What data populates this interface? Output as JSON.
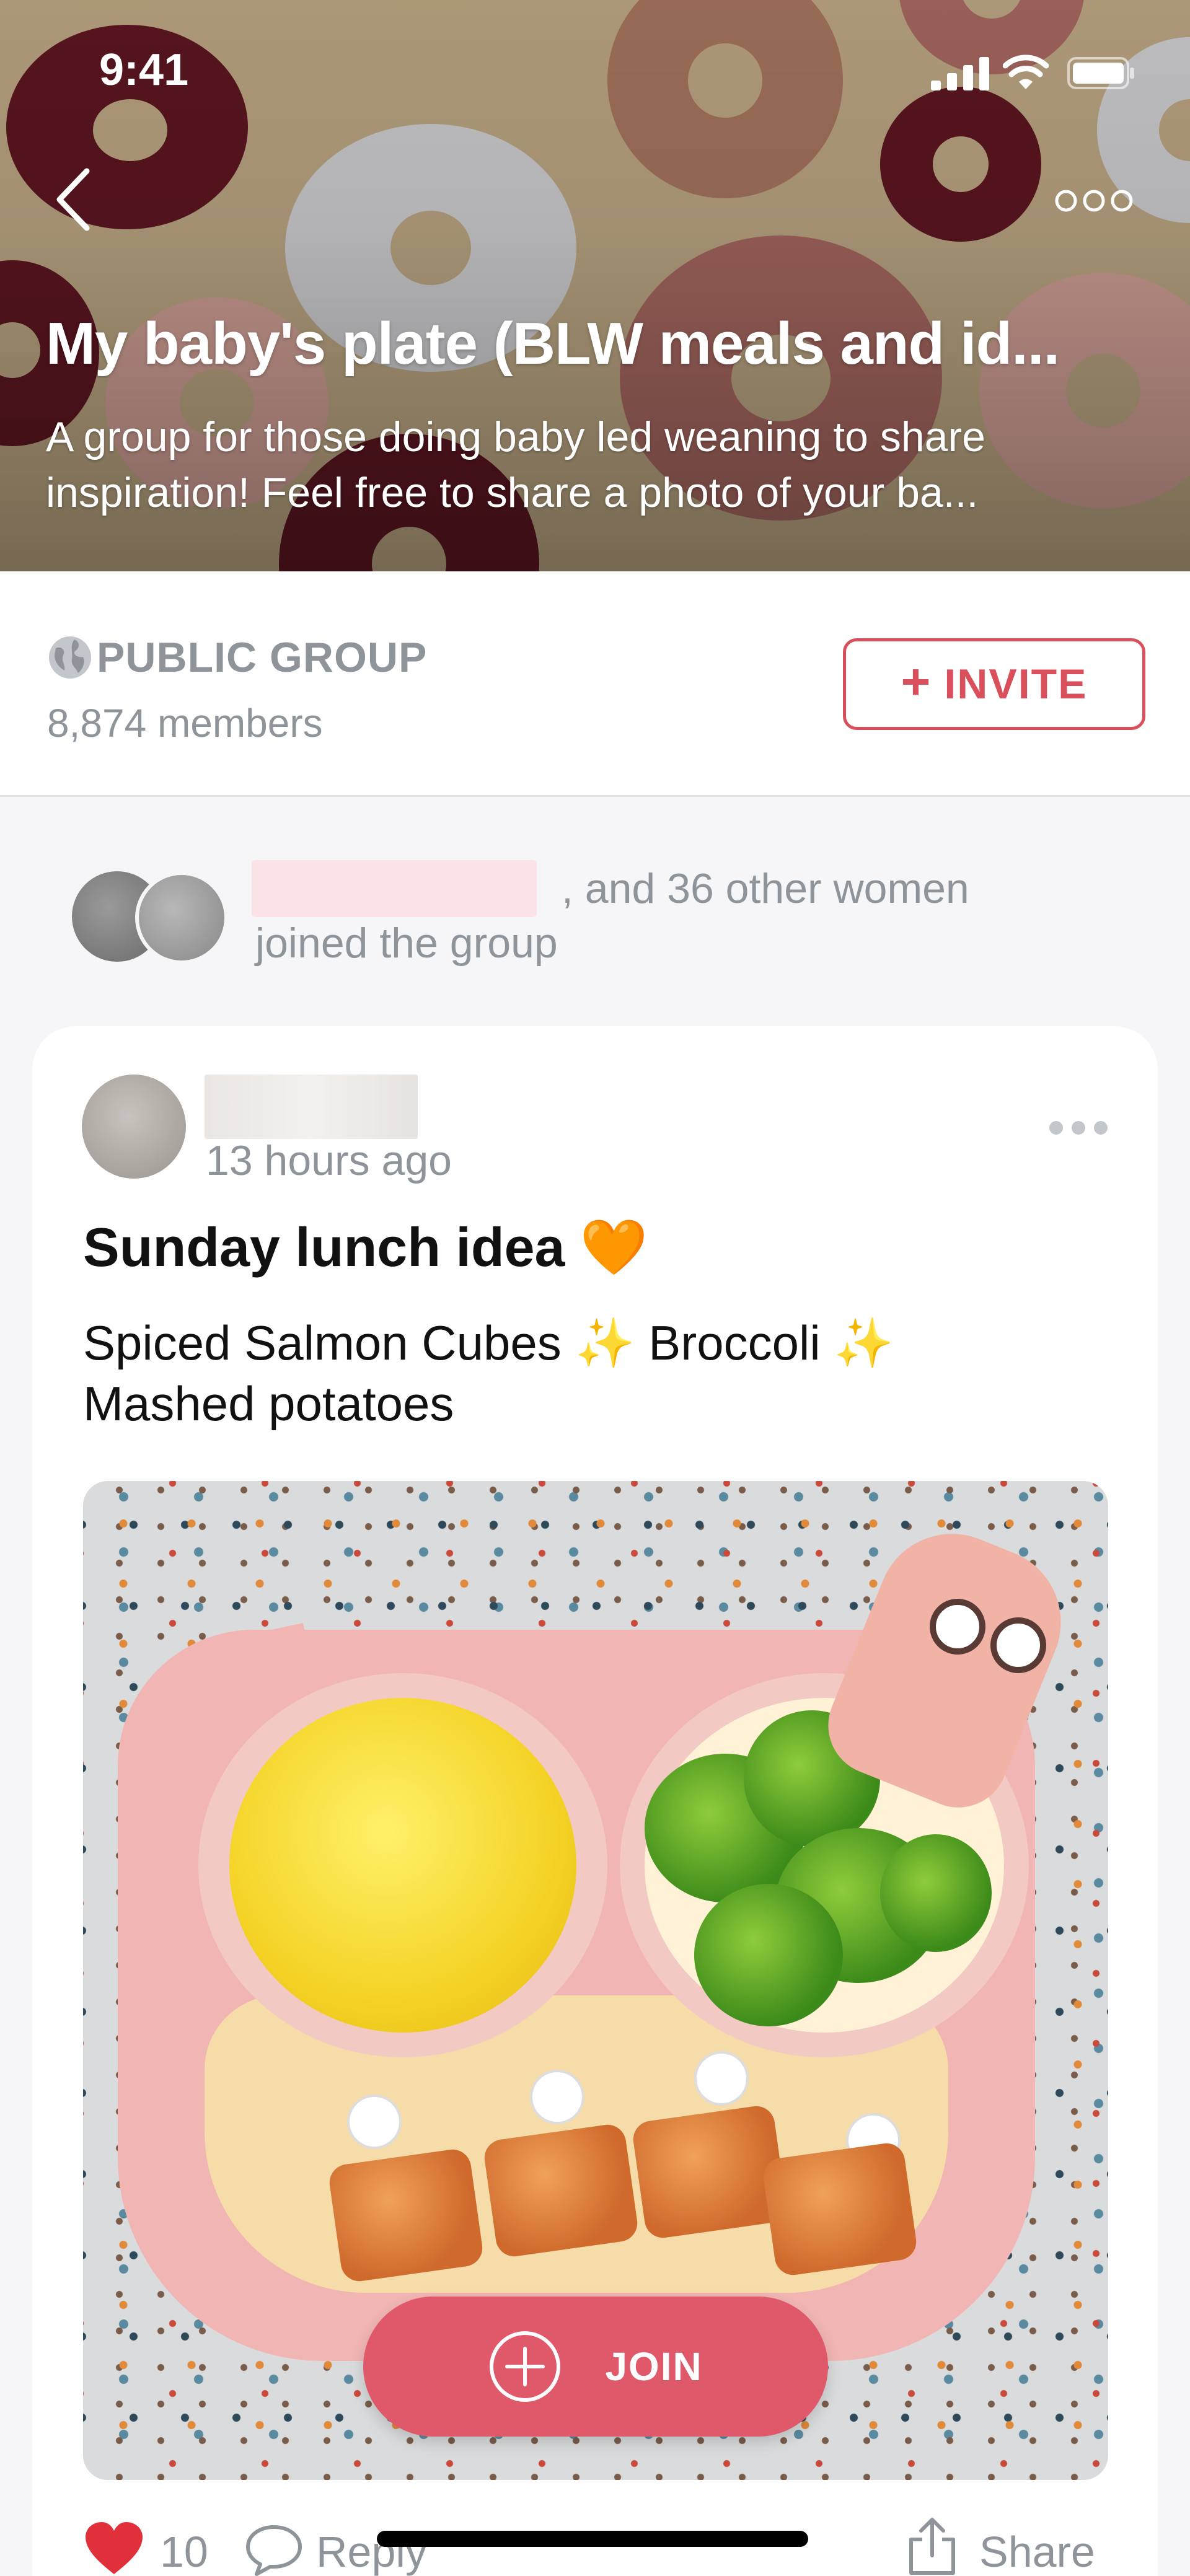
{
  "status_bar": {
    "time": "9:41"
  },
  "header": {
    "title": "My baby's plate (BLW meals and id...",
    "description": "A group for those doing baby led weaning to share inspiration! Feel free to share a photo of your ba..."
  },
  "group_info": {
    "privacy_label": "PUBLIC GROUP",
    "members": "8,874 members",
    "invite_label": "INVITE"
  },
  "joined": {
    "text": ", and 36 other women joined the group"
  },
  "post": {
    "time": "13 hours ago",
    "title": "Sunday lunch idea 🧡",
    "body": "Spiced Salmon Cubes ✨ Broccoli ✨ Mashed potatoes",
    "join_label": "JOIN",
    "likes": "10",
    "reply_label": "Reply",
    "share_label": "Share"
  },
  "icons": {
    "back": "chevron-left-icon",
    "more": "ellipsis-icon",
    "globe": "globe-icon",
    "heart": "heart-icon",
    "reply": "chat-bubble-icon",
    "share": "share-icon",
    "join": "plus-circle-icon"
  },
  "colors": {
    "accent": "#d94f5c",
    "join_button": "#e0596a",
    "muted_text": "#8f949b",
    "banner": "#b5a07e"
  }
}
